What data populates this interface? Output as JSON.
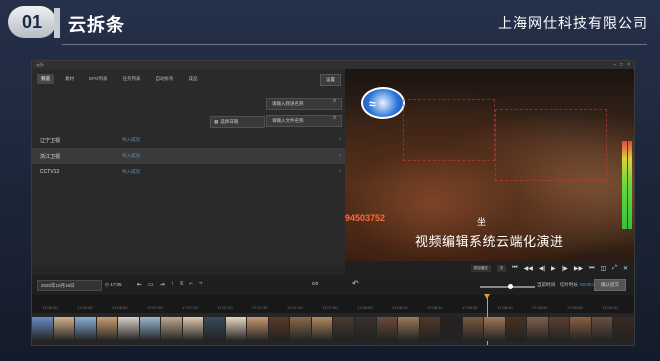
{
  "slide": {
    "number": "01",
    "title": "云拆条",
    "company": "上海网仕科技有限公司"
  },
  "app": {
    "window_title": "云拆",
    "tabs": [
      {
        "label": "频道",
        "active": true
      },
      {
        "label": "素材",
        "active": false
      },
      {
        "label": "EPG列表",
        "active": false
      },
      {
        "label": "任务列表",
        "active": false
      },
      {
        "label": "自动拆条",
        "active": false
      },
      {
        "label": "成品",
        "active": false
      }
    ],
    "settings_label": "设置",
    "channel_search_placeholder": "请输入频道名称",
    "file_search_placeholder": "请输入文件名称",
    "date_picker_label": "选择日期",
    "channels": [
      {
        "name": "辽宁卫视",
        "status": "导入成功",
        "selected": false
      },
      {
        "name": "浙江卫视",
        "status": "导入成功",
        "selected": true
      },
      {
        "name": "CCTV13",
        "status": "导入成功",
        "selected": false
      }
    ],
    "video": {
      "watermark_number": "94503752",
      "subtitle_small": "坐",
      "subtitle_main": "视频编辑系统云端化演进",
      "mini_btn_1": "原始播放",
      "mini_btn_2": "关"
    },
    "toolbar": {
      "date_value": "2020年10月19日",
      "time_value": "17:05",
      "count": "0/0",
      "current_label": "当前时间",
      "cut_label": "切片时长",
      "cut_value": "00:00:00",
      "upload_label": "确认提交"
    },
    "ruler_ticks": [
      "17:06:30",
      "17:06:40",
      "17:06:50",
      "17:07:00",
      "17:07:10",
      "17:07:20",
      "17:07:30",
      "17:07:40",
      "17:07:50",
      "17:08:00",
      "17:08:10",
      "17:08:20",
      "17:08:30",
      "17:08:40",
      "17:08:50",
      "17:09:00",
      "17:09:10"
    ],
    "thumb_colors": [
      "#6a8cc4",
      "#d4b08a",
      "#88b0d8",
      "#c8a070",
      "#d8d0c8",
      "#9ab8d0",
      "#c0a890",
      "#e0c8b0",
      "#3a4a5a",
      "#e8d8c0",
      "#c89870",
      "#5a3a2a",
      "#8a6a4a",
      "#b08860",
      "#4a3a30",
      "#3a3030",
      "#6a4a3a",
      "#9a7a5a",
      "#503828",
      "#2a2020",
      "#7a5a40",
      "#a07858",
      "#4a3020",
      "#806050",
      "#5a4030",
      "#8a6040",
      "#6a5040",
      "#3a2a20"
    ],
    "colors": {
      "accent": "#3da0e8",
      "playhead": "#e0a020",
      "watermark": "#ff6a3a"
    }
  }
}
